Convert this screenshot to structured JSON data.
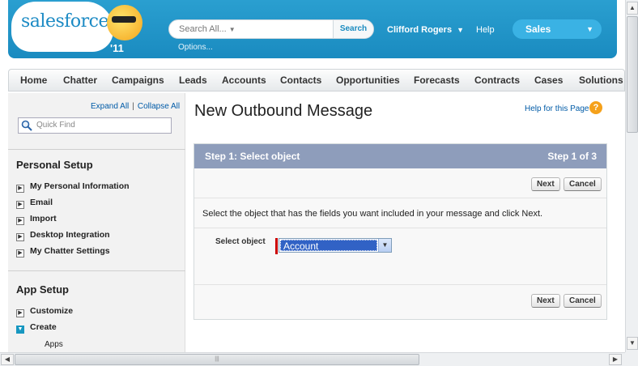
{
  "header": {
    "logo_text": "salesforce",
    "logo_year": "'11",
    "search_placeholder": "Search All...",
    "search_button": "Search",
    "options_link": "Options...",
    "user_name": "Clifford Rogers",
    "help_link": "Help",
    "app_selector": "Sales"
  },
  "nav": {
    "tabs": [
      "Home",
      "Chatter",
      "Campaigns",
      "Leads",
      "Accounts",
      "Contacts",
      "Opportunities",
      "Forecasts",
      "Contracts",
      "Cases",
      "Solutions"
    ]
  },
  "sidebar": {
    "expand_all": "Expand All",
    "collapse_all": "Collapse All",
    "quick_find_placeholder": "Quick Find",
    "personal_setup_title": "Personal Setup",
    "personal_items": [
      "My Personal Information",
      "Email",
      "Import",
      "Desktop Integration",
      "My Chatter Settings"
    ],
    "app_setup_title": "App Setup",
    "app_items": [
      {
        "label": "Customize",
        "expanded": false
      },
      {
        "label": "Create",
        "expanded": true
      }
    ],
    "create_children": [
      "Apps"
    ]
  },
  "main": {
    "title": "New Outbound Message",
    "help_link": "Help for this Page",
    "step_title": "Step 1: Select object",
    "step_counter": "Step 1 of 3",
    "next_button": "Next",
    "cancel_button": "Cancel",
    "instructions": "Select the object that has the fields you want included in your message and click Next.",
    "select_label": "Select object",
    "selected_object": "Account"
  },
  "colors": {
    "header_blue": "#1a8bc0",
    "step_header": "#8e9dbb",
    "link_blue": "#015ba7",
    "required_red": "#cc0000"
  }
}
